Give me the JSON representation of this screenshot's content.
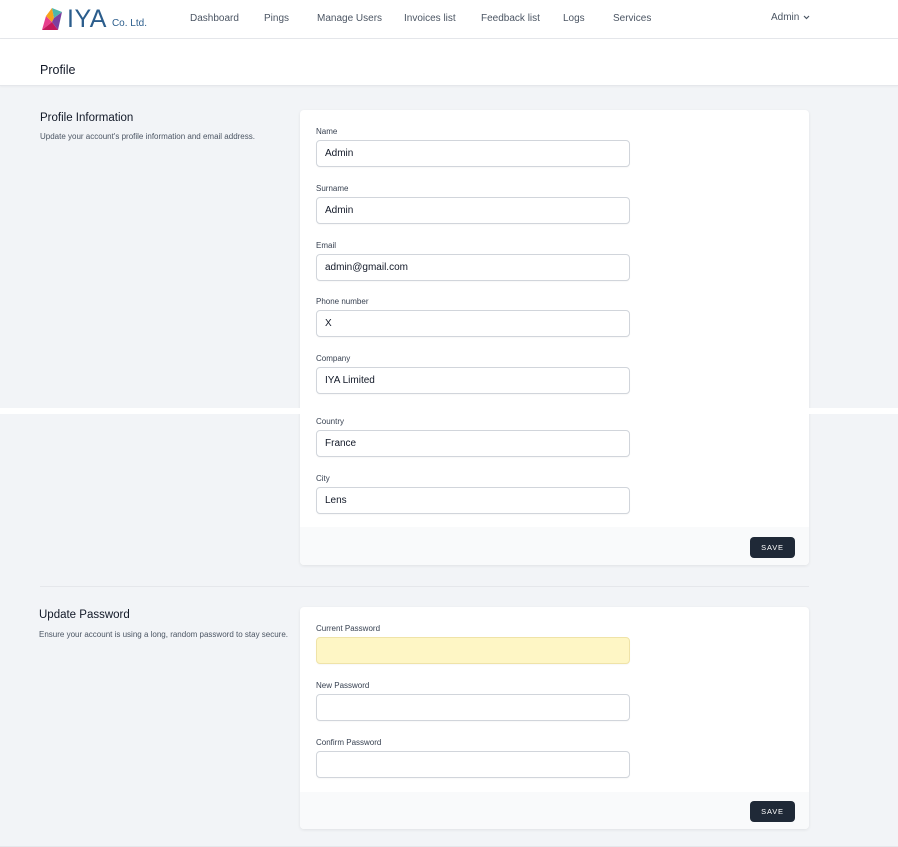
{
  "brand": {
    "name": "IYA",
    "suffix": "Co. Ltd."
  },
  "nav": {
    "items": [
      {
        "label": "Dashboard"
      },
      {
        "label": "Pings"
      },
      {
        "label": "Manage Users"
      },
      {
        "label": "Invoices list"
      },
      {
        "label": "Feedback list"
      },
      {
        "label": "Logs"
      },
      {
        "label": "Services"
      }
    ],
    "user": "Admin"
  },
  "page": {
    "title": "Profile"
  },
  "profile_section": {
    "title": "Profile Information",
    "description": "Update your account's profile information and email address.",
    "fields": [
      {
        "label": "Name",
        "value": "Admin"
      },
      {
        "label": "Surname",
        "value": "Admin"
      },
      {
        "label": "Email",
        "value": "admin@gmail.com"
      },
      {
        "label": "Phone number",
        "value": "X"
      },
      {
        "label": "Company",
        "value": "IYA Limited"
      },
      {
        "label": "Country",
        "value": "France"
      },
      {
        "label": "City",
        "value": "Lens"
      }
    ],
    "save_label": "SAVE"
  },
  "password_section": {
    "title": "Update Password",
    "description": "Ensure your account is using a long, random password to stay secure.",
    "fields": [
      {
        "label": "Current Password",
        "value": ""
      },
      {
        "label": "New Password",
        "value": ""
      },
      {
        "label": "Confirm Password",
        "value": ""
      }
    ],
    "save_label": "SAVE"
  },
  "colors": {
    "background": "#f2f4f7",
    "button": "#1f2937",
    "autofill": "#fef6c5",
    "brand": "#2b5d8c"
  }
}
